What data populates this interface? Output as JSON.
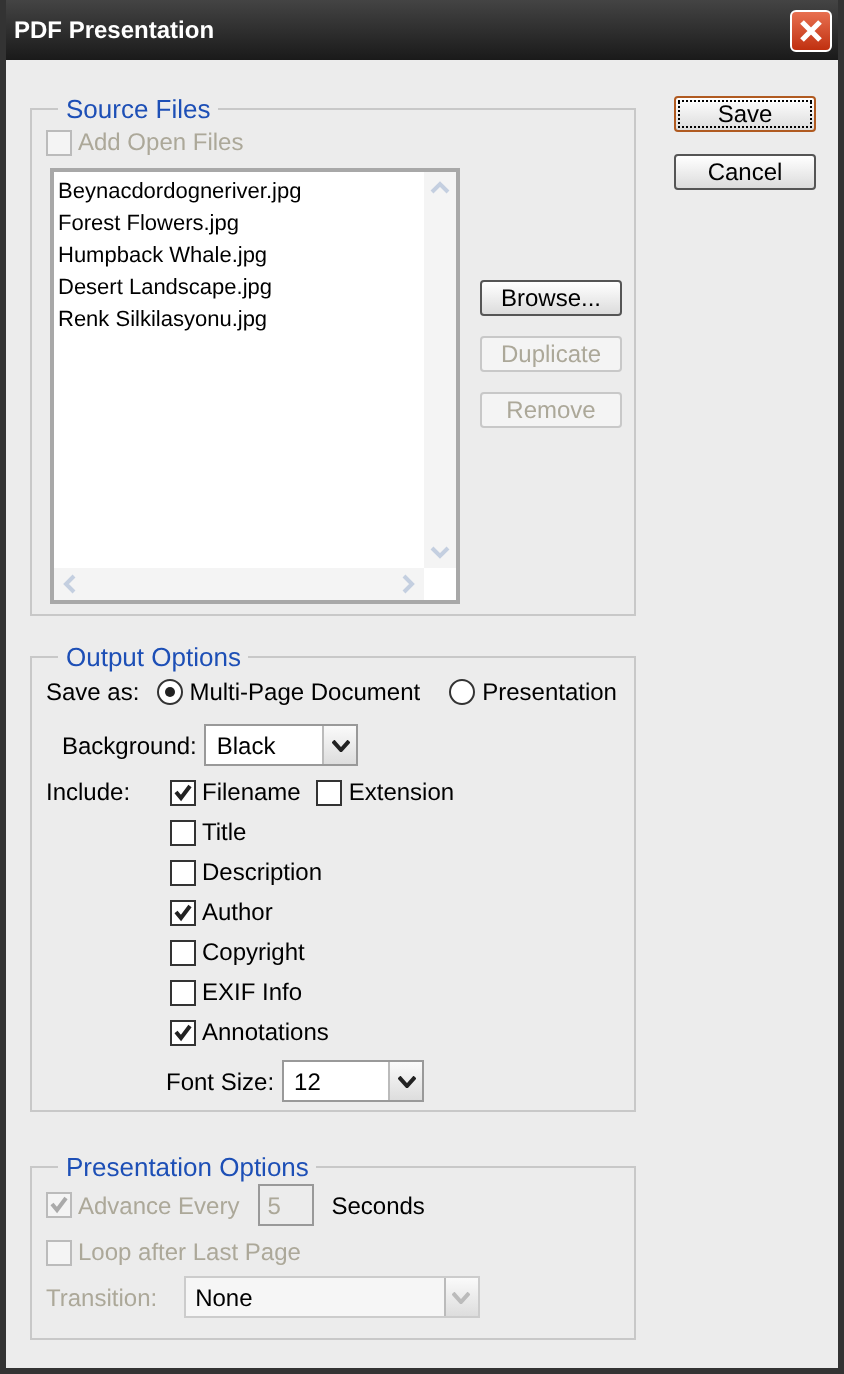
{
  "window": {
    "title": "PDF Presentation"
  },
  "source_files": {
    "title": "Source Files",
    "add_open_files": {
      "label": "Add Open Files",
      "checked": false,
      "disabled": true
    },
    "files": [
      "Beynacdordogneriver.jpg",
      "Forest Flowers.jpg",
      "Humpback Whale.jpg",
      "Desert Landscape.jpg",
      "Renk Silkilasyonu.jpg"
    ],
    "buttons": [
      {
        "label": "Browse...",
        "disabled": false
      },
      {
        "label": "Duplicate",
        "disabled": true
      },
      {
        "label": "Remove",
        "disabled": true
      }
    ]
  },
  "dialog_buttons": [
    {
      "label": "Save",
      "default": true
    },
    {
      "label": "Cancel",
      "default": false
    }
  ],
  "output_options": {
    "title": "Output Options",
    "save_as": {
      "label": "Save as:",
      "options": [
        {
          "label": "Multi-Page Document",
          "selected": true
        },
        {
          "label": "Presentation",
          "selected": false
        }
      ]
    },
    "background": {
      "label": "Background:",
      "value": "Black"
    },
    "include": {
      "label": "Include:",
      "items": [
        {
          "label": "Filename",
          "checked": true
        },
        {
          "label": "Extension",
          "checked": false
        },
        {
          "label": "Title",
          "checked": false
        },
        {
          "label": "Description",
          "checked": false
        },
        {
          "label": "Author",
          "checked": true
        },
        {
          "label": "Copyright",
          "checked": false
        },
        {
          "label": "EXIF Info",
          "checked": false
        },
        {
          "label": "Annotations",
          "checked": true
        }
      ]
    },
    "font_size": {
      "label": "Font Size:",
      "value": "12"
    }
  },
  "presentation_options": {
    "title": "Presentation Options",
    "advance": {
      "label": "Advance Every",
      "checked": true,
      "disabled": true,
      "value": "5",
      "unit": "Seconds"
    },
    "loop": {
      "label": "Loop after Last Page",
      "checked": false,
      "disabled": true
    },
    "transition": {
      "label": "Transition:",
      "value": "None",
      "disabled": true
    }
  }
}
